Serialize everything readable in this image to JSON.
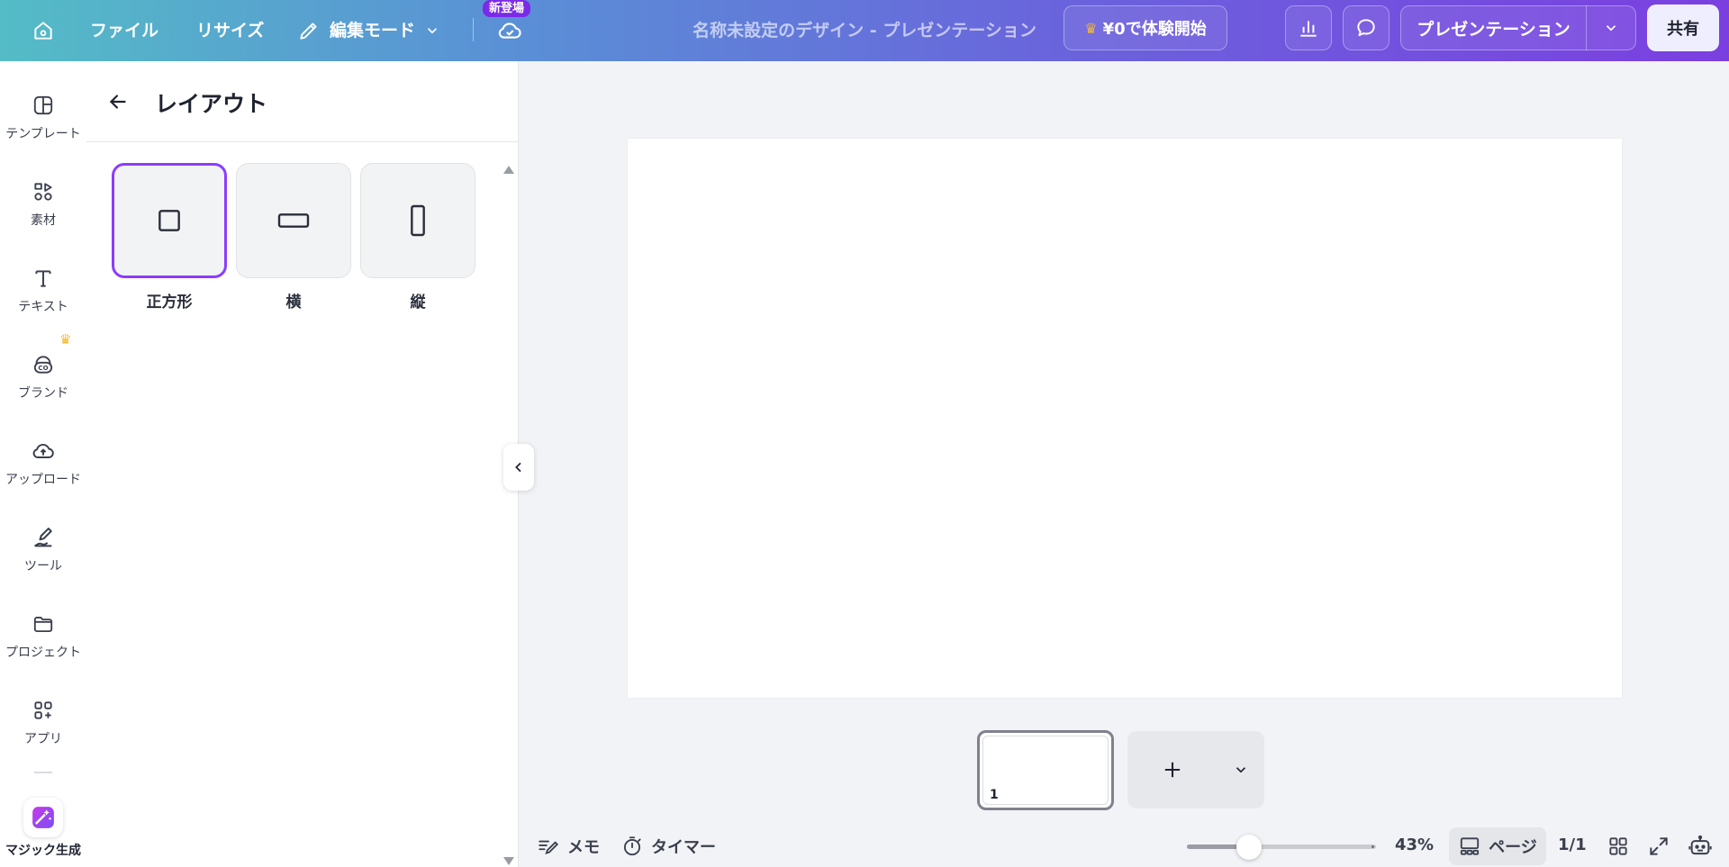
{
  "topbar": {
    "file": "ファイル",
    "resize": "リサイズ",
    "edit_mode": "編集モード",
    "new_badge": "新登場",
    "doc_title": "名称未設定のデザイン - プレゼンテーション",
    "trial": "¥0で体験開始",
    "present": "プレゼンテーション",
    "share": "共有",
    "accent": "#8b3dff"
  },
  "rail": {
    "items": [
      {
        "label": "テンプレート",
        "icon": "template-icon"
      },
      {
        "label": "素材",
        "icon": "elements-icon"
      },
      {
        "label": "テキスト",
        "icon": "text-icon"
      },
      {
        "label": "ブランド",
        "icon": "brand-icon"
      },
      {
        "label": "アップロード",
        "icon": "upload-icon"
      },
      {
        "label": "ツール",
        "icon": "draw-icon"
      },
      {
        "label": "プロジェクト",
        "icon": "folder-icon"
      },
      {
        "label": "アプリ",
        "icon": "apps-icon"
      }
    ],
    "magic": "マジック生成"
  },
  "panel": {
    "title": "レイアウト",
    "options": [
      {
        "label": "正方形",
        "selected": true
      },
      {
        "label": "横",
        "selected": false
      },
      {
        "label": "縦",
        "selected": false
      }
    ]
  },
  "pages": {
    "thumb_number": "1"
  },
  "bottom": {
    "memo": "メモ",
    "timer": "タイマー",
    "zoom": "43%",
    "zoom_fraction": 0.33,
    "pages_label": "ページ",
    "page_count": "1/1"
  }
}
